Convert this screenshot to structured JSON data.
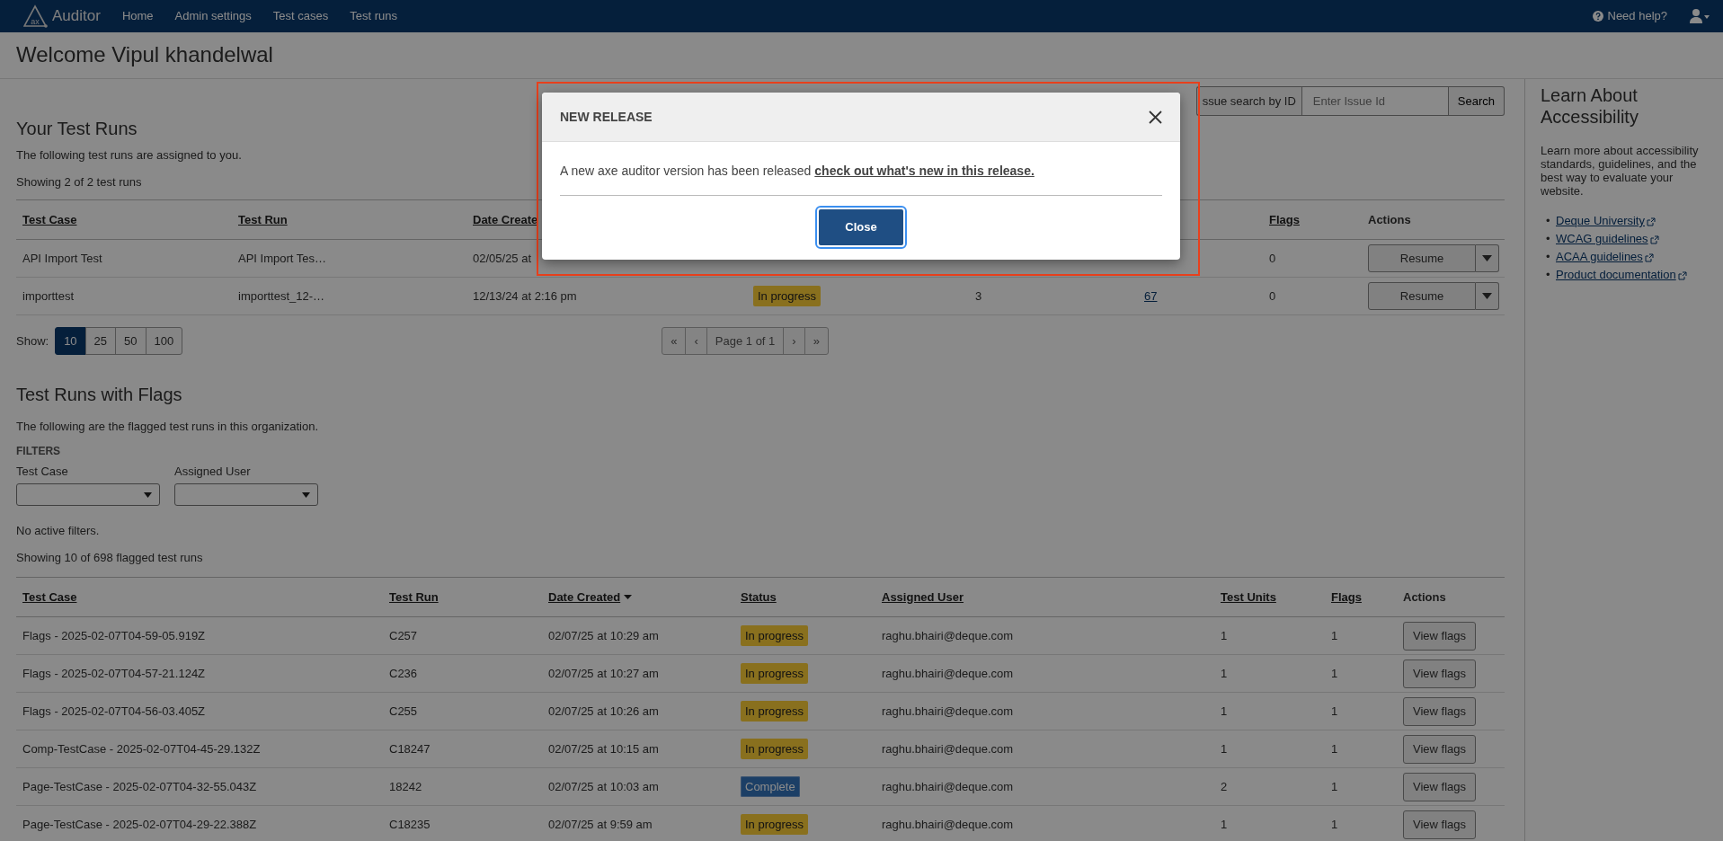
{
  "navbar": {
    "logo_mark": "ax",
    "brand": "Auditor",
    "links": [
      {
        "label": "Home"
      },
      {
        "label": "Admin settings"
      },
      {
        "label": "Test cases"
      },
      {
        "label": "Test runs"
      }
    ],
    "help": "Need help?"
  },
  "page_title": "Welcome Vipul khandelwal",
  "issue_search": {
    "label": "ssue search by ID",
    "placeholder": "Enter Issue Id",
    "button": "Search"
  },
  "your_test_runs": {
    "title": "Your Test Runs",
    "description": "The following test runs are assigned to you.",
    "showing": "Showing 2 of 2 test runs",
    "columns": [
      {
        "label": "Test Case",
        "sortable": true
      },
      {
        "label": "Test Run",
        "sortable": true
      },
      {
        "label": "Date Create",
        "sortable": true
      },
      null,
      null,
      null,
      {
        "label": "Flags",
        "sortable": true
      },
      {
        "label": "Actions",
        "sortable": false
      }
    ],
    "rows": [
      {
        "cells": [
          "API Import Test",
          "API Import Tes…",
          "02/05/25 at",
          null,
          null,
          null,
          "0",
          {
            "kind": "split_button",
            "label": "Resume"
          }
        ]
      },
      {
        "cells": [
          "importtest",
          "importtest_12-…",
          "12/13/24 at 2:16 pm",
          {
            "kind": "badge",
            "label": "In progress",
            "color": "#89701f"
          },
          "3",
          {
            "kind": "link",
            "text": "67"
          },
          "0",
          {
            "kind": "split_button",
            "label": "Resume"
          }
        ]
      }
    ],
    "show_label": "Show:",
    "page_sizes": [
      {
        "label": "10",
        "selected": true
      },
      {
        "label": "25",
        "selected": false
      },
      {
        "label": "50",
        "selected": false
      },
      {
        "label": "100",
        "selected": false
      }
    ],
    "pagination": [
      "«",
      "‹",
      "Page 1 of 1",
      "›",
      "»"
    ]
  },
  "flagged_test_runs": {
    "title": "Test Runs with Flags",
    "description": "The following are the flagged test runs in this organization.",
    "filters_title": "FILTERS",
    "filters": [
      {
        "label": "Test Case"
      },
      {
        "label": "Assigned User"
      }
    ],
    "filter_status": "No active filters.",
    "showing": "Showing 10 of 698 flagged test runs",
    "columns": [
      {
        "label": "Test Case",
        "sortable": true
      },
      {
        "label": "Test Run",
        "sortable": true
      },
      {
        "label": "Date Created",
        "sortable": true,
        "sorted": true
      },
      {
        "label": "Status",
        "sortable": true
      },
      {
        "label": "Assigned User",
        "sortable": true
      },
      {
        "label": "Test Units",
        "sortable": true
      },
      {
        "label": "Flags",
        "sortable": true
      },
      {
        "label": "Actions",
        "sortable": false
      }
    ],
    "rows": [
      {
        "cells": [
          "Flags - 2025-02-07T04-59-05.919Z",
          "C257",
          "02/07/25 at 10:29 am",
          {
            "kind": "badge",
            "label": "In progress",
            "color": "#89701f"
          },
          "raghu.bhairi@deque.com",
          "1",
          "1",
          {
            "kind": "button",
            "label": "View flags"
          }
        ]
      },
      {
        "cells": [
          "Flags - 2025-02-07T04-57-21.124Z",
          "C236",
          "02/07/25 at 10:27 am",
          {
            "kind": "badge",
            "label": "In progress",
            "color": "#89701f"
          },
          "raghu.bhairi@deque.com",
          "1",
          "1",
          {
            "kind": "button",
            "label": "View flags"
          }
        ]
      },
      {
        "cells": [
          "Flags - 2025-02-07T04-56-03.405Z",
          "C255",
          "02/07/25 at 10:26 am",
          {
            "kind": "badge",
            "label": "In progress",
            "color": "#89701f"
          },
          "raghu.bhairi@deque.com",
          "1",
          "1",
          {
            "kind": "button",
            "label": "View flags"
          }
        ]
      },
      {
        "cells": [
          "Comp-TestCase - 2025-02-07T04-45-29.132Z",
          "C18247",
          "02/07/25 at 10:15 am",
          {
            "kind": "badge",
            "label": "In progress",
            "color": "#89701f"
          },
          "raghu.bhairi@deque.com",
          "1",
          "1",
          {
            "kind": "button",
            "label": "View flags"
          }
        ]
      },
      {
        "cells": [
          "Page-TestCase - 2025-02-07T04-32-55.043Z",
          "18242",
          "02/07/25 at 10:03 am",
          {
            "kind": "badge",
            "label": "Complete",
            "color": "#1c3f66"
          },
          "raghu.bhairi@deque.com",
          "2",
          "1",
          {
            "kind": "button",
            "label": "View flags"
          }
        ]
      },
      {
        "cells": [
          "Page-TestCase - 2025-02-07T04-29-22.388Z",
          "C18235",
          "02/07/25 at 9:59 am",
          {
            "kind": "badge",
            "label": "In progress",
            "color": "#89701f"
          },
          "raghu.bhairi@deque.com",
          "1",
          "1",
          {
            "kind": "button",
            "label": "View flags"
          }
        ]
      }
    ]
  },
  "sidebar": {
    "title": "Learn About Accessibility",
    "bullet": "•",
    "text": "Learn more about accessibility standards, guidelines, and the best way to evaluate your website.",
    "links": [
      {
        "label": "Deque University"
      },
      {
        "label": "WCAG guidelines"
      },
      {
        "label": "ACAA guidelines"
      },
      {
        "label": "Product documentation"
      }
    ]
  },
  "modal": {
    "title": "NEW RELEASE",
    "text": "A new axe auditor version has been released",
    "link": "check out what's new in this release.",
    "button": "Close"
  }
}
